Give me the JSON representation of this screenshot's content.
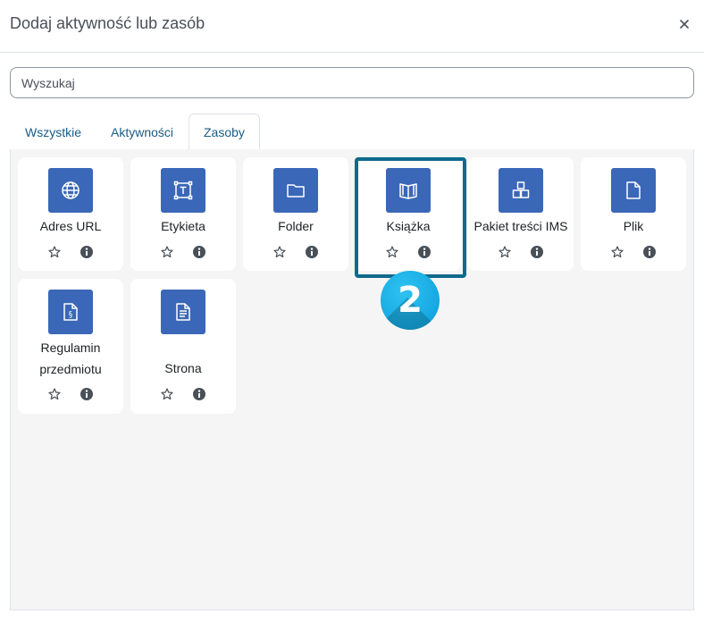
{
  "dialog": {
    "title": "Dodaj aktywność lub zasób",
    "close_icon": "close-icon"
  },
  "search": {
    "placeholder": "Wyszukaj",
    "value": ""
  },
  "tabs": [
    {
      "label": "Wszystkie",
      "active": false
    },
    {
      "label": "Aktywności",
      "active": false
    },
    {
      "label": "Zasoby",
      "active": true
    }
  ],
  "items": [
    {
      "label": "Adres URL",
      "icon": "globe-icon"
    },
    {
      "label": "Etykieta",
      "icon": "text-frame-icon"
    },
    {
      "label": "Folder",
      "icon": "folder-icon"
    },
    {
      "label": "Książka",
      "icon": "book-icon"
    },
    {
      "label": "Pakiet treści IMS",
      "icon": "boxes-icon"
    },
    {
      "label": "Plik",
      "icon": "file-icon"
    },
    {
      "label": "Regulamin przedmiotu",
      "icon": "regulation-document-icon"
    },
    {
      "label": "Strona",
      "icon": "page-icon"
    }
  ],
  "callout": {
    "number": "2"
  },
  "colors": {
    "icon_bg": "#3a67b7",
    "highlight": "#0e6a8c",
    "badge": "#1aaee6",
    "tab_text": "#1a5c86"
  }
}
